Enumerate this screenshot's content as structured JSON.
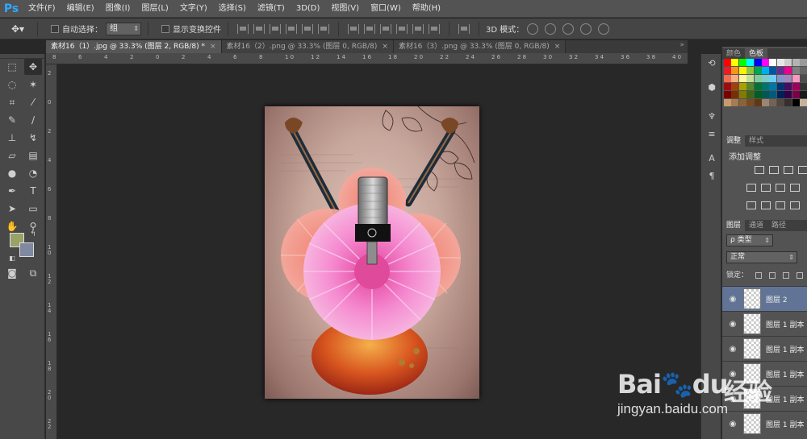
{
  "app": {
    "logo": "Ps"
  },
  "menu": [
    "文件(F)",
    "编辑(E)",
    "图像(I)",
    "图层(L)",
    "文字(Y)",
    "选择(S)",
    "滤镜(T)",
    "3D(D)",
    "视图(V)",
    "窗口(W)",
    "帮助(H)"
  ],
  "options": {
    "auto_select_label": "自动选择：",
    "auto_select_value": "组",
    "show_transform_label": "显示变换控件",
    "mode_3d_label": "3D 模式："
  },
  "tabs": [
    {
      "label": "素材16（1）.jpg @ 33.3% (图层 2, RGB/8) *",
      "active": true
    },
    {
      "label": "素材16（2）.png @ 33.3% (图层 0, RGB/8)",
      "active": false
    },
    {
      "label": "素材16（3）.png @ 33.3% (图层 0, RGB/8)",
      "active": false
    }
  ],
  "ruler": {
    "top": [
      "8",
      "6",
      "4",
      "2",
      "0",
      "2",
      "4",
      "6",
      "8",
      "1 0",
      "1 2",
      "1 4",
      "1 6",
      "1 8",
      "2 0",
      "2 2",
      "2 4",
      "2 6",
      "2 8",
      "3 0",
      "3 2",
      "3 4",
      "3 6",
      "3 8",
      "4 0"
    ],
    "left": [
      "2",
      "0",
      "2",
      "4",
      "6",
      "8",
      "1 0",
      "1 2",
      "1 4",
      "1 6",
      "1 8",
      "2 0",
      "2 2"
    ]
  },
  "colors": {
    "foreground": "#9aa169",
    "background": "#7f8aa0",
    "accent": "#31a8ff",
    "selection": "#617496"
  },
  "panels": {
    "swatch_tabs": [
      "颜色",
      "色板"
    ],
    "adjust_tabs": [
      "调整",
      "样式"
    ],
    "adjust_title": "添加调整",
    "layer_tabs": [
      "图层",
      "通道",
      "路径"
    ],
    "layer_kind": "ρ 类型",
    "blend_mode": "正常",
    "lock_label": "锁定：",
    "layers": [
      {
        "name": "图层 2",
        "selected": true
      },
      {
        "name": "图层 1 副本",
        "selected": false
      },
      {
        "name": "图层 1 副本",
        "selected": false
      },
      {
        "name": "图层 1 副本",
        "selected": false
      },
      {
        "name": "图层 1 副本",
        "selected": false
      },
      {
        "name": "图层 1 副本",
        "selected": false
      }
    ]
  },
  "watermark": {
    "brand": "Bai",
    "brand2": "du",
    "cn": "经验",
    "url": "jingyan.baidu.com"
  }
}
